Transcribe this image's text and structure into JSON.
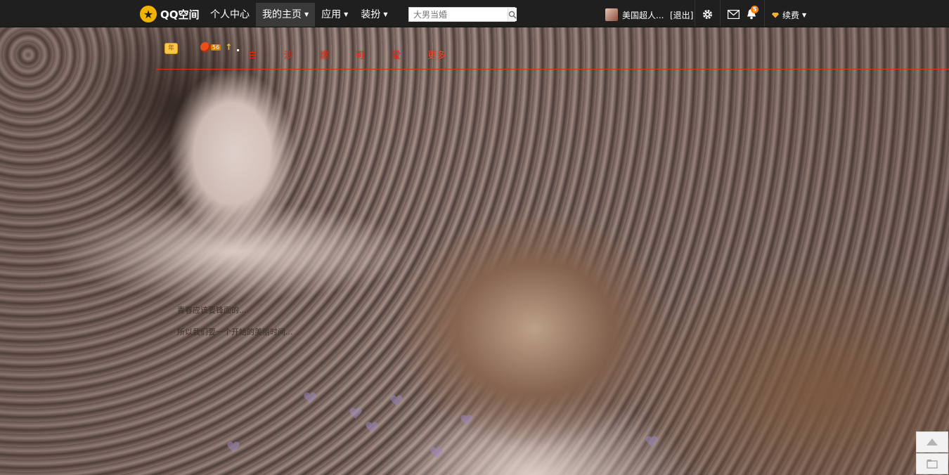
{
  "topbar": {
    "logo_text": "QQ空间",
    "nav": [
      {
        "label": "个人中心",
        "has_menu": false
      },
      {
        "label": "我的主页",
        "has_menu": true
      },
      {
        "label": "应用",
        "has_menu": true
      },
      {
        "label": "装扮",
        "has_menu": true
      }
    ],
    "search_placeholder": "大男当婚",
    "user_name": "美国超人...",
    "logout_label": "[退出]",
    "notification_count": "5",
    "renew_label": "续费"
  },
  "profile": {
    "year_badge": "年",
    "level": "56",
    "menu": [
      "白",
      "沙",
      "爆",
      "可",
      "爱",
      "更多"
    ]
  },
  "posts": [
    "青春应该要锋面的...",
    "所以我们要一个开始的美丽时间..."
  ],
  "icons": {
    "logo": "qzone-star-icon",
    "search": "search-icon",
    "settings": "gear-icon",
    "mail": "mail-icon",
    "notifications": "bell-icon",
    "renew": "diamond-icon",
    "back_to_top": "arrow-up-icon",
    "feedback": "feedback-icon"
  },
  "colors": {
    "topbar_bg": "#1f1f1f",
    "menu_text": "#f02a14",
    "badge": "#ff7d00",
    "logo": "#f0b400"
  }
}
